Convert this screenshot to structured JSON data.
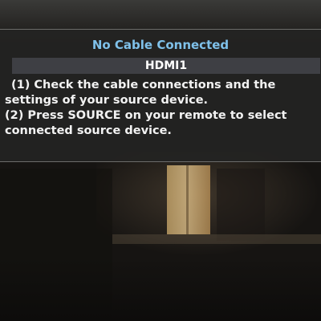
{
  "osd": {
    "title": "No Cable Connected",
    "source": "HDMI1",
    "instructions": [
      "(1) Check the cable connections and the settings of your source device.",
      "(2) Press SOURCE on your remote to select connected source device."
    ]
  },
  "colors": {
    "title": "#7fc1ea",
    "text": "#f2f2f2",
    "source_bar": "#3e3f44",
    "panel": "#242422"
  }
}
